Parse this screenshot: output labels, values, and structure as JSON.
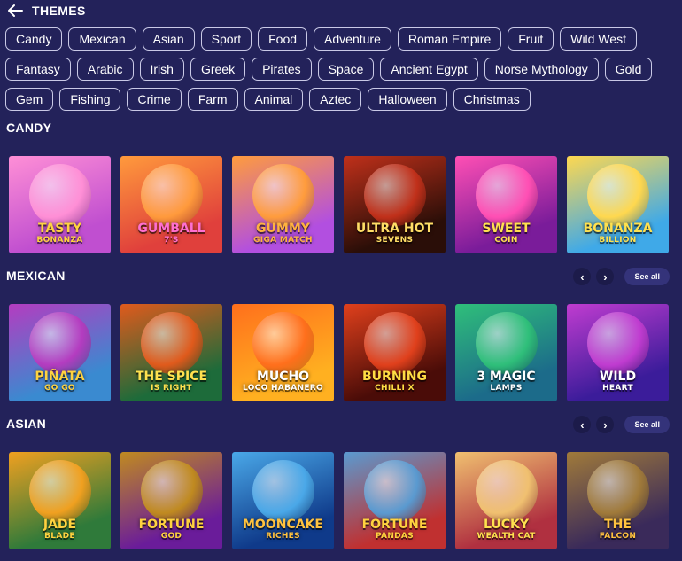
{
  "header": {
    "title": "THEMES"
  },
  "chips": [
    "Candy",
    "Mexican",
    "Asian",
    "Sport",
    "Food",
    "Adventure",
    "Roman Empire",
    "Fruit",
    "Wild West",
    "Fantasy",
    "Arabic",
    "Irish",
    "Greek",
    "Pirates",
    "Space",
    "Ancient Egypt",
    "Norse Mythology",
    "Gold",
    "Gem",
    "Fishing",
    "Crime",
    "Farm",
    "Animal",
    "Aztec",
    "Halloween",
    "Christmas"
  ],
  "sections": {
    "candy": {
      "title": "CANDY",
      "games": [
        {
          "name": "TASTY",
          "sub": "BONANZA",
          "bg": "#c04fd0",
          "bg2": "#ff8fd6",
          "text": "#ffd23f"
        },
        {
          "name": "Gumball",
          "sub": "7's",
          "bg": "#e0403c",
          "bg2": "#ff9a3c",
          "text": "#ff6fd0"
        },
        {
          "name": "GUMMY",
          "sub": "GIGA MATCH",
          "bg": "#b24fe0",
          "bg2": "#ff9c3c",
          "text": "#ffb23f"
        },
        {
          "name": "ULTRA HOT",
          "sub": "SEVENS",
          "bg": "#2a0e08",
          "bg2": "#c0301a",
          "text": "#ffdd66"
        },
        {
          "name": "SWEET",
          "sub": "COIN",
          "bg": "#7a1c9a",
          "bg2": "#ff4fb4",
          "text": "#ffe14f"
        },
        {
          "name": "BONANZA",
          "sub": "BILLION",
          "bg": "#3fa9e8",
          "bg2": "#ffd84f",
          "text": "#ffe14f"
        }
      ]
    },
    "mexican": {
      "title": "MEXICAN",
      "see_all": "See all",
      "games": [
        {
          "name": "PIÑATA",
          "sub": "GO GO",
          "bg": "#3a8ad0",
          "bg2": "#b43cc0",
          "text": "#ffd23f"
        },
        {
          "name": "The Spice",
          "sub": "is Right",
          "bg": "#1d6b3a",
          "bg2": "#e05a1c",
          "text": "#ffe14f"
        },
        {
          "name": "Mucho",
          "sub": "Loco Habanero",
          "bg": "#ffb020",
          "bg2": "#ff6f1c",
          "text": "#ffffff"
        },
        {
          "name": "BURNING",
          "sub": "CHILLI X",
          "bg": "#4a0c08",
          "bg2": "#e0401c",
          "text": "#ffdd44"
        },
        {
          "name": "3 Magic",
          "sub": "lamps",
          "bg": "#1c6b8a",
          "bg2": "#2fbf7a",
          "text": "#ffffff"
        },
        {
          "name": "WILD",
          "sub": "HEART",
          "bg": "#3b1c9a",
          "bg2": "#c03cd0",
          "text": "#ffffff"
        }
      ]
    },
    "asian": {
      "title": "ASIAN",
      "see_all": "See all",
      "games": [
        {
          "name": "JADE",
          "sub": "BLADE",
          "bg": "#2f7a3a",
          "bg2": "#f0a020",
          "text": "#ffd23f"
        },
        {
          "name": "FORTUNE",
          "sub": "GOD",
          "bg": "#6a1c9a",
          "bg2": "#c08a20",
          "text": "#ffd23f"
        },
        {
          "name": "MOONCAKE",
          "sub": "RICHES",
          "bg": "#0f3a8a",
          "bg2": "#4aa8e8",
          "text": "#ffc23f"
        },
        {
          "name": "FORTUNE",
          "sub": "PANDAS",
          "bg": "#c03030",
          "bg2": "#5a9ad0",
          "text": "#ffd23f"
        },
        {
          "name": "LUCKY",
          "sub": "WEALTH CAT",
          "bg": "#b03040",
          "bg2": "#f0c070",
          "text": "#ffe14f"
        },
        {
          "name": "THE",
          "sub": "FALCON",
          "bg": "#3a2a5a",
          "bg2": "#a07a3a",
          "text": "#ffc23f"
        }
      ]
    }
  }
}
